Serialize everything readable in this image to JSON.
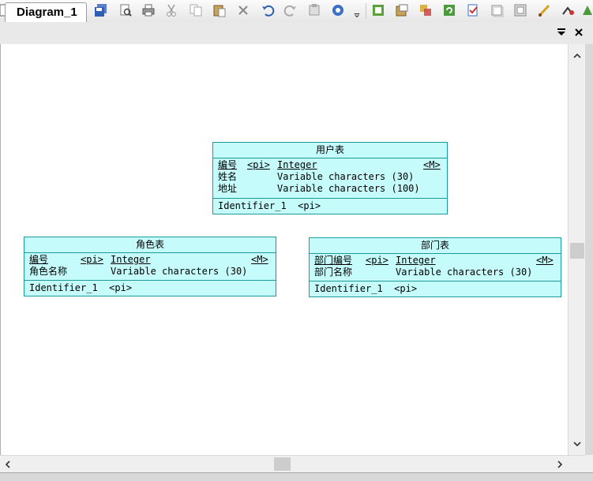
{
  "toolbar": {
    "icons": [
      "new-icon",
      "package-icon",
      "open-folder-icon",
      "save-icon",
      "save-all-icon",
      "print-preview-icon",
      "print-icon",
      "cut-icon",
      "copy-icon",
      "paste-icon",
      "delete-icon",
      "undo-icon",
      "redo-icon",
      "properties-icon",
      "find-icon",
      "overflow-icon",
      "check-model-icon",
      "generate-icon",
      "compare-icon",
      "refresh-icon",
      "validate-icon",
      "window-icon",
      "layout-icon",
      "brush-icon",
      "link-icon",
      "reverse-icon"
    ]
  },
  "tab": {
    "label": "Diagram_1"
  },
  "entities": [
    {
      "title": "用户表",
      "attributes": [
        {
          "name": "编号",
          "key": "<pi>",
          "type": "Integer",
          "mandatory": "<M>"
        },
        {
          "name": "姓名",
          "key": "",
          "type": "Variable characters (30)",
          "mandatory": ""
        },
        {
          "name": "地址",
          "key": "",
          "type": "Variable characters (100)",
          "mandatory": ""
        }
      ],
      "identifier": "Identifier_1  <pi>"
    },
    {
      "title": "角色表",
      "attributes": [
        {
          "name": "编号",
          "key": "<pi>",
          "type": "Integer",
          "mandatory": "<M>"
        },
        {
          "name": "角色名称",
          "key": "",
          "type": "Variable characters (30)",
          "mandatory": ""
        }
      ],
      "identifier": "Identifier_1  <pi>"
    },
    {
      "title": "部门表",
      "attributes": [
        {
          "name": "部门编号",
          "key": "<pi>",
          "type": "Integer",
          "mandatory": "<M>"
        },
        {
          "name": "部门名称",
          "key": "",
          "type": "Variable characters (30)",
          "mandatory": ""
        }
      ],
      "identifier": "Identifier_1  <pi>"
    }
  ]
}
